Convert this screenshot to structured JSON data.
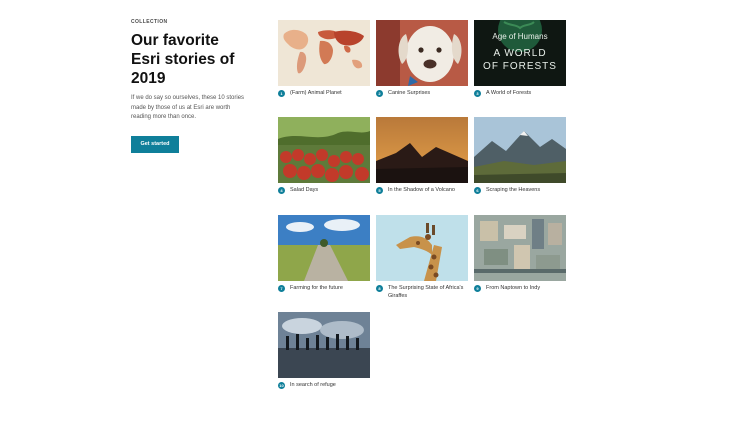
{
  "intro": {
    "kicker": "COLLECTION",
    "title": "Our favorite Esri stories of 2019",
    "description": "If we do say so ourselves, these 10 stories made by those of us at Esri are worth reading more than once.",
    "cta_label": "Get started"
  },
  "stories": [
    {
      "number": "1",
      "title": "(Farm) Animal Planet"
    },
    {
      "number": "2",
      "title": "Canine Surprises"
    },
    {
      "number": "3",
      "title": "A World of Forests",
      "cover_line1": "Age of Humans",
      "cover_line2": "A WORLD",
      "cover_line3": "OF FORESTS"
    },
    {
      "number": "4",
      "title": "Salad Days"
    },
    {
      "number": "5",
      "title": "In the Shadow of a Volcano"
    },
    {
      "number": "6",
      "title": "Scraping the Heavens"
    },
    {
      "number": "7",
      "title": "Farming for the future"
    },
    {
      "number": "8",
      "title": "The Surprising State of Africa's Giraffes"
    },
    {
      "number": "9",
      "title": "From Naptown to Indy"
    },
    {
      "number": "10",
      "title": "In search of refuge"
    }
  ],
  "colors": {
    "accent": "#0f7f9a"
  }
}
